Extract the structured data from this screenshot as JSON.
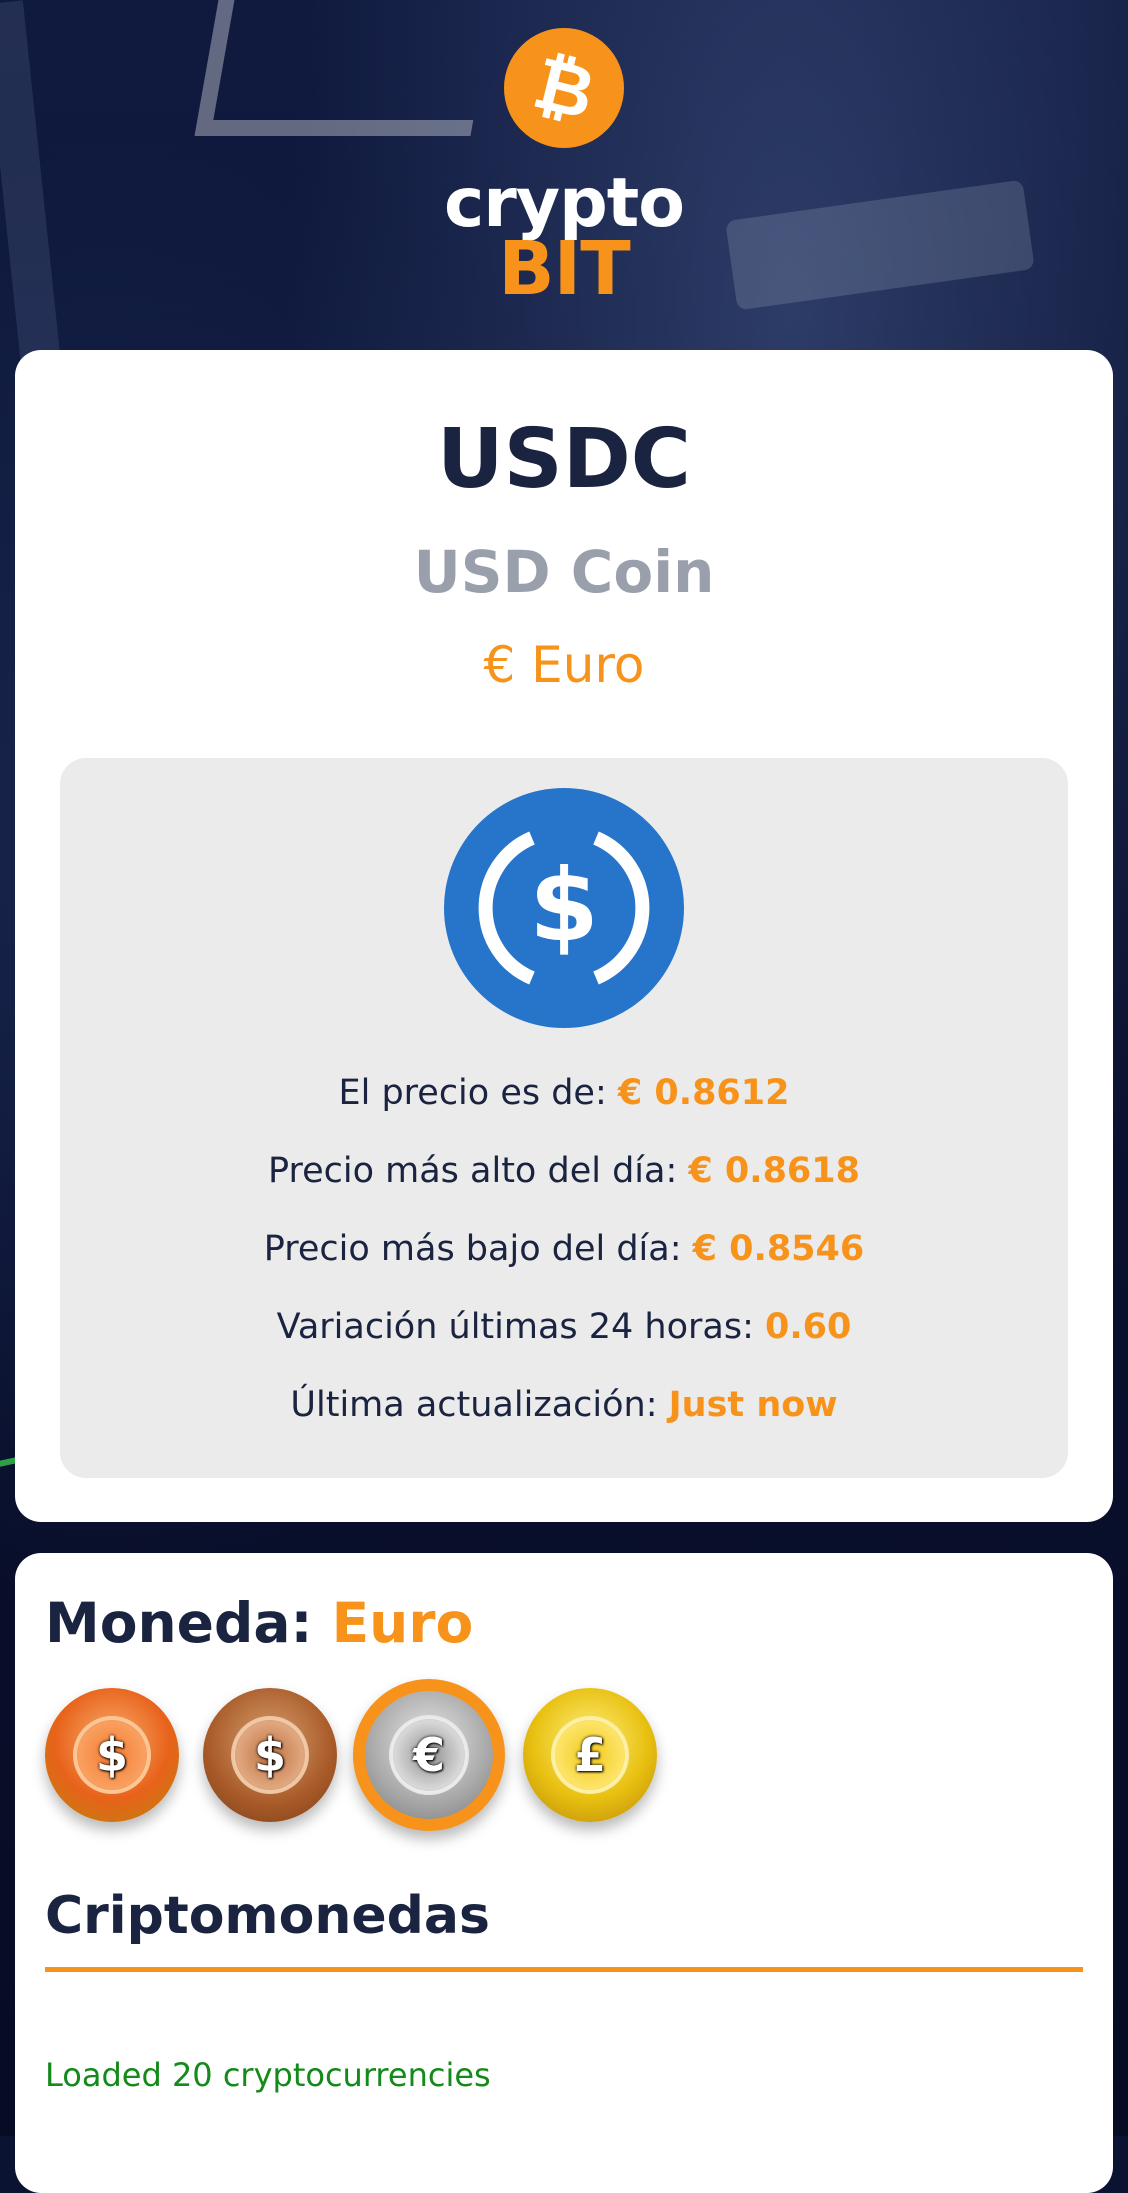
{
  "brand": {
    "top": "crypto",
    "bottom": "BIT",
    "logo_icon": "bitcoin-icon",
    "logo_glyph": "₿"
  },
  "colors": {
    "accent": "#f7931a",
    "dark_text": "#1a2340",
    "muted_text": "#9aa0ab",
    "usdc_blue": "#2775ca",
    "status_green": "#138a1a"
  },
  "crypto": {
    "symbol": "USDC",
    "name": "USD Coin",
    "currency": "€ Euro",
    "icon": "usdc-icon",
    "rows": [
      {
        "label": "El precio es de: ",
        "value": "€ 0.8612"
      },
      {
        "label": "Precio más alto del día: ",
        "value": "€ 0.8618"
      },
      {
        "label": "Precio más bajo del día: ",
        "value": "€ 0.8546"
      },
      {
        "label": "Variación últimas 24 horas: ",
        "value": "0.60"
      },
      {
        "label": "Última actualización: ",
        "value": "Just now"
      }
    ]
  },
  "selector": {
    "label": "Moneda: ",
    "selected": "Euro",
    "coins": [
      {
        "name": "dollar-orange-coin-icon",
        "symbol": "$"
      },
      {
        "name": "dollar-bronze-coin-icon",
        "symbol": "$"
      },
      {
        "name": "euro-silver-coin-icon",
        "symbol": "€"
      },
      {
        "name": "pound-gold-coin-icon",
        "symbol": "£"
      }
    ],
    "active_index": 2
  },
  "list": {
    "title": "Criptomonedas",
    "status": "Loaded 20 cryptocurrencies"
  }
}
